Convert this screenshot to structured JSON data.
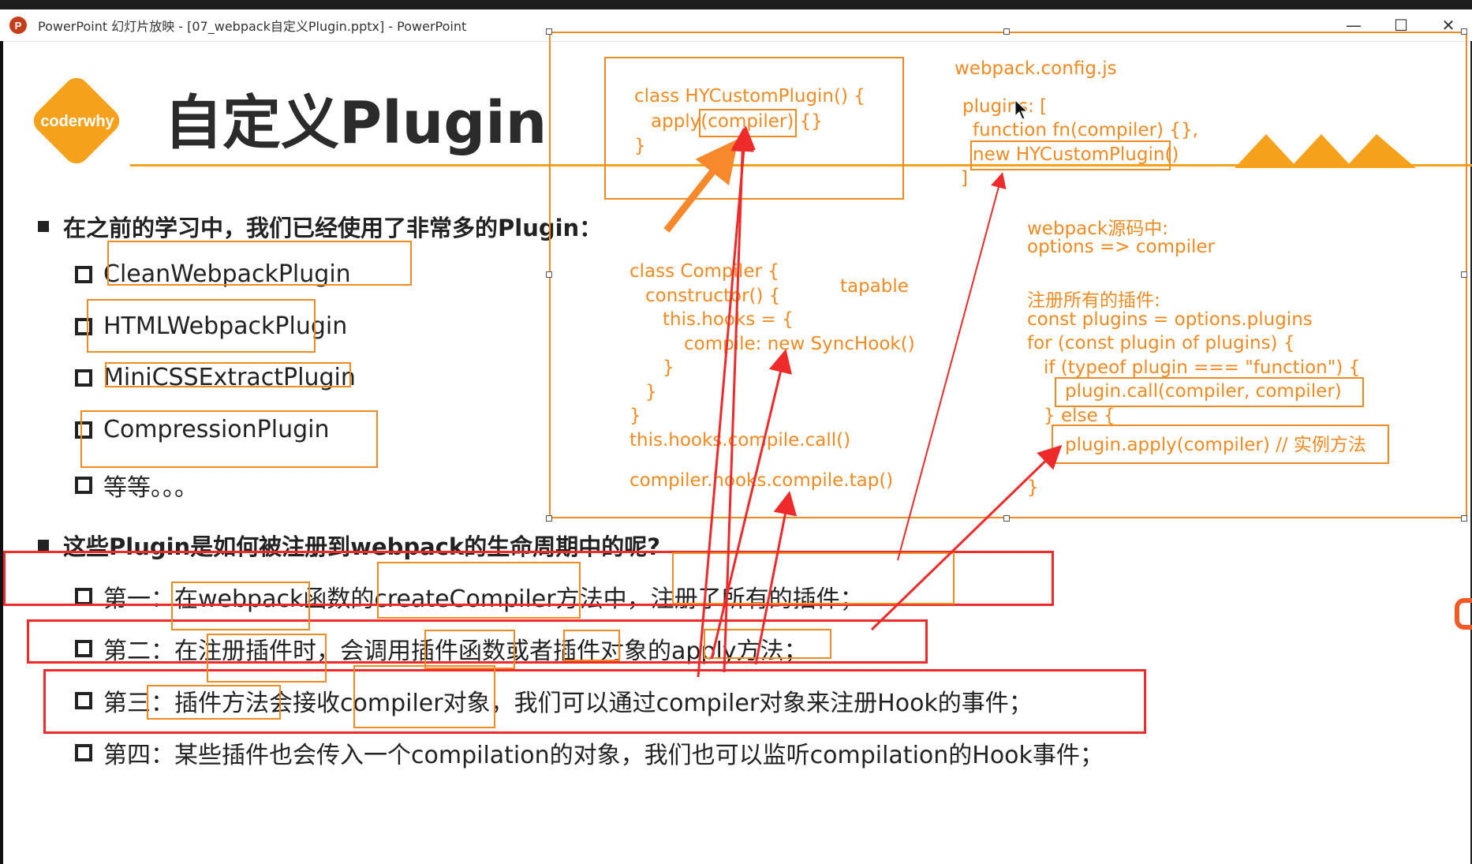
{
  "window": {
    "app_icon": "P",
    "title": "PowerPoint 幻灯片放映 - [07_webpack自定义Plugin.pptx] - PowerPoint",
    "controls": {
      "minimize": "—",
      "maximize": "☐",
      "close": "✕"
    }
  },
  "slide": {
    "logo_text": "coderwhy",
    "title": "自定义Plugin",
    "accent_color": "#f5a11c",
    "section1": {
      "heading": "在之前的学习中，我们已经使用了非常多的Plugin：",
      "items": [
        "CleanWebpackPlugin",
        "HTMLWebpackPlugin",
        "MiniCSSExtractPlugin",
        "CompressionPlugin",
        "等等。。。"
      ]
    },
    "section2": {
      "heading": "这些Plugin是如何被注册到webpack的生命周期中的呢?",
      "items": [
        "第一：在webpack函数的createCompiler方法中，注册了所有的插件；",
        "第二：在注册插件时，会调用插件函数或者插件对象的apply方法；",
        "第三：插件方法会接收compiler对象，我们可以通过compiler对象来注册Hook的事件；",
        "第四：某些插件也会传入一个compilation的对象，我们也可以监听compilation的Hook事件；"
      ]
    }
  },
  "annotations": {
    "color": "#f08a22",
    "red_color": "#ee2a2a",
    "plugin_class": [
      "class HYCustomPlugin() {",
      "apply(compiler) {}",
      "}"
    ],
    "config": [
      "webpack.config.js",
      "plugins: [",
      "function fn(compiler) {},",
      "new HYCustomPlugin()",
      "]"
    ],
    "compiler_class": [
      "class Compiler {",
      "constructor() {",
      "this.hooks = {",
      "compile: new SyncHook()",
      "}",
      "}",
      "}",
      "this.hooks.compile.call()",
      "compiler.hooks.compile.tap()"
    ],
    "tapable": "tapable",
    "source": [
      "webpack源码中:",
      "options => compiler",
      "注册所有的插件:",
      "const plugins = options.plugins",
      "for (const plugin of plugins) {",
      "if (typeof plugin === \"function\") {",
      "plugin.call(compiler, compiler)",
      "} else {",
      "plugin.apply(compiler) // 实例方法",
      "}"
    ]
  }
}
